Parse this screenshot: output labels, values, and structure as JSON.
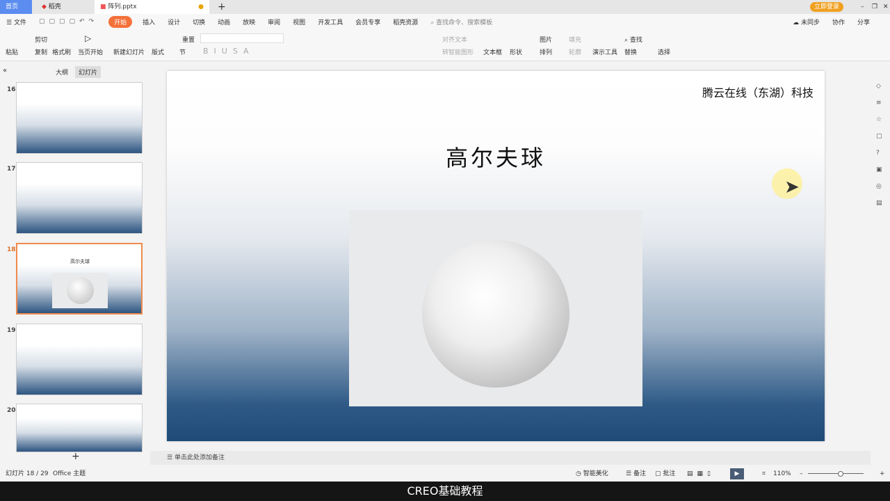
{
  "tabs": [
    {
      "label": "首页"
    },
    {
      "label": "稻壳"
    },
    {
      "label": "阵列.pptx"
    }
  ],
  "window": {
    "login": "立即登录"
  },
  "menu": [
    "文件",
    "开始",
    "插入",
    "设计",
    "切换",
    "动画",
    "放映",
    "审阅",
    "视图",
    "开发工具",
    "会员专享",
    "稻壳资源"
  ],
  "search_placeholder": "查找命令、搜索模板",
  "top_right": {
    "sync": "未同步",
    "collab": "协作",
    "share": "分享"
  },
  "ribbon": {
    "paste": "粘贴",
    "cut": "剪切",
    "copy": "复制",
    "format_painter": "格式刷",
    "play_current": "当页开始",
    "new_slide": "新建幻灯片",
    "layout": "版式",
    "reset": "重置",
    "section": "节",
    "align_text": "对齐文本",
    "smartart": "转智能图形",
    "textbox": "文本框",
    "shape": "形状",
    "picture": "图片",
    "fill": "填充",
    "arrange": "排列",
    "outline": "轮廓",
    "present_tools": "演示工具",
    "find": "查找",
    "replace": "替换",
    "select": "选择"
  },
  "panel_tabs": {
    "outline": "大纲",
    "slides": "幻灯片"
  },
  "thumbnails": [
    {
      "num": "16"
    },
    {
      "num": "17"
    },
    {
      "num": "18",
      "title": "高尔夫球"
    },
    {
      "num": "19"
    },
    {
      "num": "20"
    }
  ],
  "slide": {
    "company": "腾云在线（东湖）科技",
    "title": "高尔夫球"
  },
  "notes_placeholder": "单击此处添加备注",
  "status": {
    "slide_count": "幻灯片 18 / 29",
    "theme": "Office 主题",
    "beautify": "智能美化",
    "notes": "备注",
    "comment": "批注",
    "zoom": "110%"
  },
  "subtitle": "CREO基础教程",
  "colors": {
    "accent": "#f4713a"
  }
}
